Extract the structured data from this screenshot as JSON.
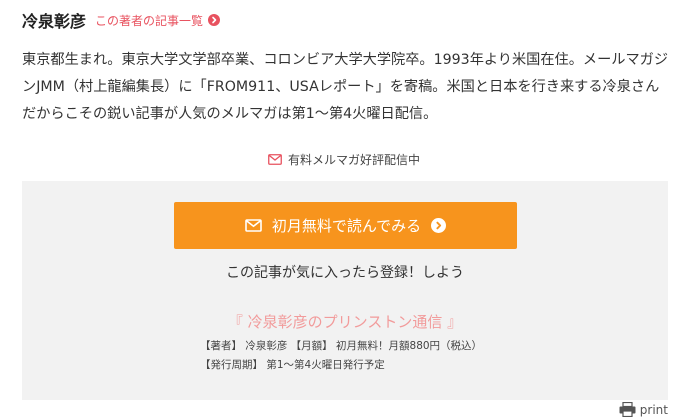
{
  "author": {
    "name": "冷泉彰彦",
    "articles_link": "この著者の記事一覧",
    "bio": "東京都生まれ。東京大学文学部卒業、コロンビア大学大学院卒。1993年より米国在住。メールマガジンJMM（村上龍編集長）に「FROM911、USAレポート」を寄稿。米国と日本を行き来する冷泉さんだからこその鋭い記事が人気のメルマガは第1〜第4火曜日配信。"
  },
  "subscription": {
    "tagline": "有料メルマガ好評配信中",
    "cta_label": "初月無料で読んでみる",
    "note_before": "この記事が気に入ったら",
    "note_link": "登録",
    "note_after": "！しよう",
    "magazine_title": "『 冷泉彰彦のプリンストン通信 』",
    "info": "【著者】 冷泉彰彦 【月額】 初月無料！月額880円（税込） 【発行周期】 第1〜第4火曜日発行予定"
  },
  "print_label": "print",
  "colors": {
    "accent_red": "#e8525f",
    "cta_orange": "#f7941d",
    "magazine_pink": "#f29b9b",
    "box_background": "#f2f2f2"
  },
  "icons": [
    "chevron-circle-right-icon",
    "mail-icon",
    "printer-icon"
  ]
}
